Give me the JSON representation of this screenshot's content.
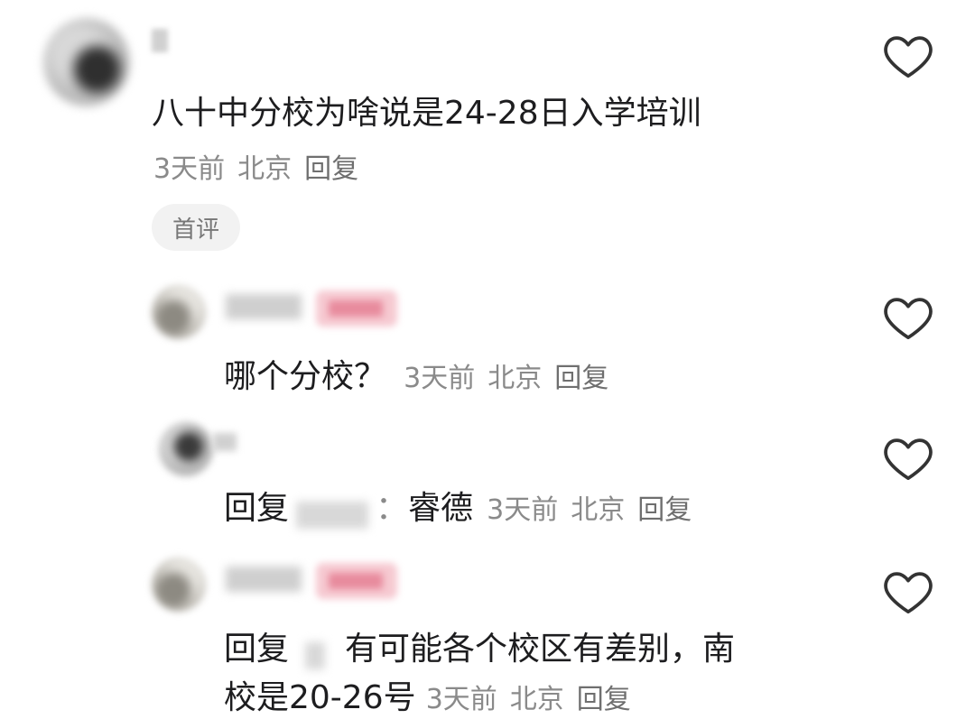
{
  "top_comment": {
    "text": "八十中分校为啥说是24-28日入学培训",
    "time": "3天前",
    "location": "北京",
    "reply_label": "回复",
    "badge": "首评"
  },
  "replies": [
    {
      "text": "哪个分校？",
      "time": "3天前",
      "location": "北京",
      "reply_label": "回复"
    },
    {
      "reply_prefix": "回复",
      "colon": "：",
      "text": "睿德",
      "time": "3天前",
      "location": "北京",
      "reply_label": "回复"
    },
    {
      "reply_prefix": "回复",
      "text_line1": "有可能各个校区有差别，南",
      "text_line2": "校是20-26号",
      "time": "3天前",
      "location": "北京",
      "reply_label": "回复"
    }
  ],
  "icons": {
    "like": "heart-outline-icon"
  },
  "colors": {
    "text": "#1d1d1f",
    "meta": "#8a8a8a",
    "badge_bg": "#f2f2f2",
    "author_tag": "#f6c9d1"
  }
}
